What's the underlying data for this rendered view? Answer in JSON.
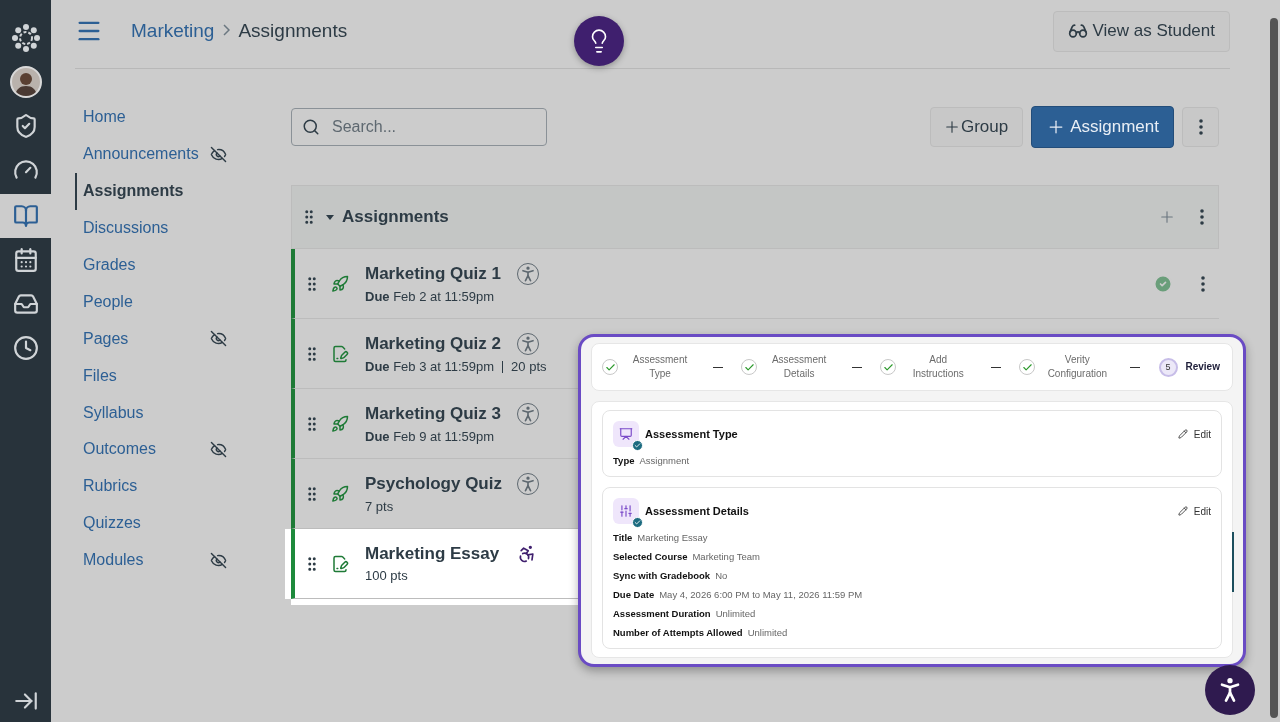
{
  "global_nav": [
    {
      "kind": "logo",
      "selected": false
    },
    {
      "kind": "account",
      "selected": false
    },
    {
      "kind": "admin",
      "selected": false
    },
    {
      "kind": "dashboard",
      "selected": false
    },
    {
      "kind": "courses",
      "selected": true
    },
    {
      "kind": "calendar",
      "selected": false
    },
    {
      "kind": "inbox",
      "selected": false
    },
    {
      "kind": "history",
      "selected": false
    }
  ],
  "breadcrumb": [
    "Marketing",
    "Assignments"
  ],
  "view_as_student": "View as Student",
  "course_nav": [
    {
      "label": "Home",
      "selected": false,
      "hidden": false
    },
    {
      "label": "Announcements",
      "selected": false,
      "hidden": true
    },
    {
      "label": "Assignments",
      "selected": true,
      "hidden": false
    },
    {
      "label": "Discussions",
      "selected": false,
      "hidden": false
    },
    {
      "label": "Grades",
      "selected": false,
      "hidden": false
    },
    {
      "label": "People",
      "selected": false,
      "hidden": false
    },
    {
      "label": "Pages",
      "selected": false,
      "hidden": true
    },
    {
      "label": "Files",
      "selected": false,
      "hidden": false
    },
    {
      "label": "Syllabus",
      "selected": false,
      "hidden": false
    },
    {
      "label": "Outcomes",
      "selected": false,
      "hidden": true
    },
    {
      "label": "Rubrics",
      "selected": false,
      "hidden": false
    },
    {
      "label": "Quizzes",
      "selected": false,
      "hidden": false
    },
    {
      "label": "Modules",
      "selected": false,
      "hidden": true
    }
  ],
  "search": {
    "placeholder": "Search..."
  },
  "buttons": {
    "group": "Group",
    "assignment": "Assignment"
  },
  "group": {
    "title": "Assignments",
    "expanded": true
  },
  "assignments": [
    {
      "kind": "quiz",
      "title": "Marketing Quiz 1",
      "meta": [
        "**Due** Feb 2 at 11:59pm"
      ],
      "highlighted": false,
      "published": true
    },
    {
      "kind": "assignment",
      "title": "Marketing Quiz 2",
      "meta": [
        "**Due** Feb 3 at 11:59pm",
        "20 pts"
      ],
      "highlighted": false
    },
    {
      "kind": "quiz",
      "title": "Marketing Quiz 3",
      "meta": [
        "**Due** Feb 9 at 11:59pm"
      ],
      "highlighted": false
    },
    {
      "kind": "quiz",
      "title": "Psychology Quiz",
      "meta": [
        "7 pts"
      ],
      "highlighted": false
    },
    {
      "kind": "assignment",
      "title": "Marketing Essay",
      "meta": [
        "100 pts"
      ],
      "highlighted": true
    }
  ],
  "review": {
    "steps": [
      {
        "label": "Assessment Type",
        "done": true
      },
      {
        "label": "Assessment Details",
        "done": true
      },
      {
        "label": "Add Instructions",
        "done": true
      },
      {
        "label": "Verity Configuration",
        "done": true
      },
      {
        "label": "Review",
        "done": false,
        "number": "5"
      }
    ],
    "sections": [
      {
        "kind": "type",
        "title": "Assessment Type",
        "edit": "Edit",
        "fields": [
          {
            "label": "Type",
            "value": "Assignment"
          }
        ]
      },
      {
        "kind": "details",
        "title": "Assessment Details",
        "edit": "Edit",
        "fields": [
          {
            "label": "Title",
            "value": "Marketing Essay"
          },
          {
            "label": "Selected Course",
            "value": "Marketing Team"
          },
          {
            "label": "Sync with Gradebook",
            "value": "No"
          },
          {
            "label": "Due Date",
            "value": "May 4, 2026 6:00 PM to May 11, 2026 11:59 PM"
          },
          {
            "label": "Assessment Duration",
            "value": "Unlimited"
          },
          {
            "label": "Number of Attempts Allowed",
            "value": "Unlimited"
          }
        ]
      }
    ]
  }
}
